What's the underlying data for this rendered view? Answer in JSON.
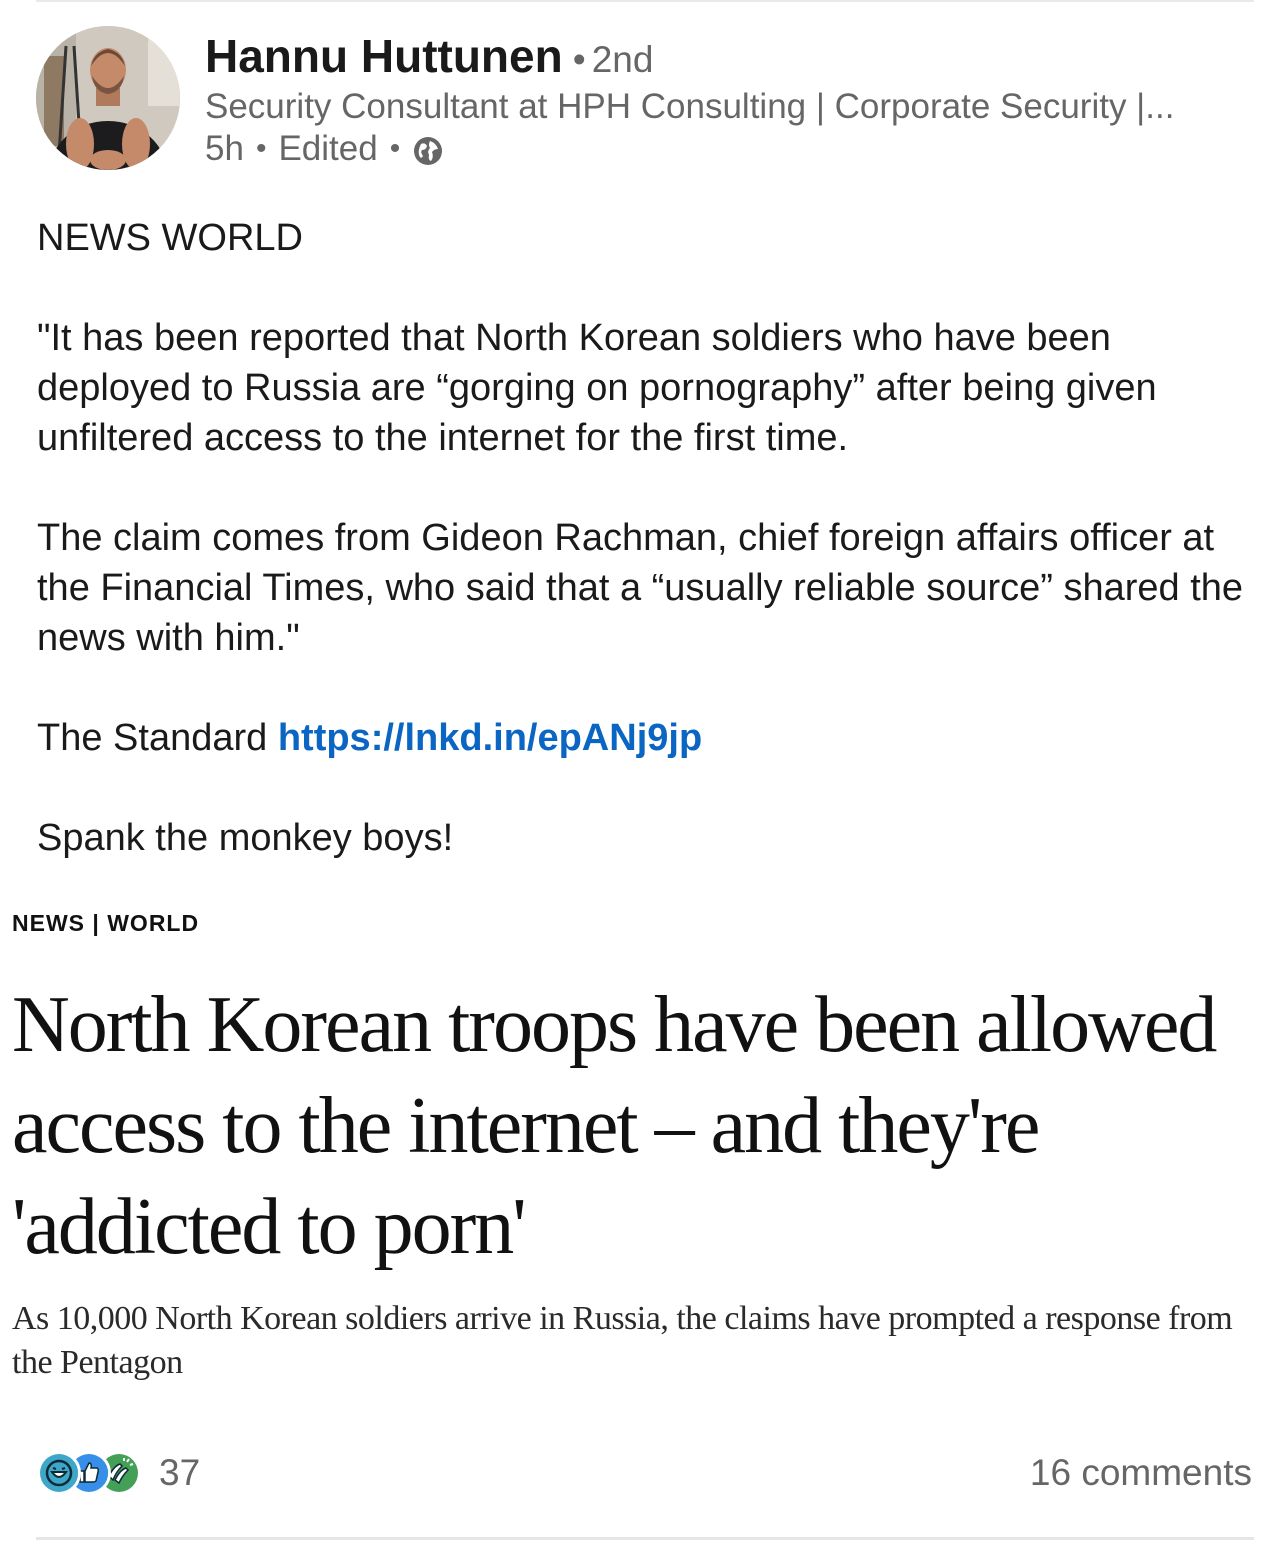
{
  "author": {
    "name": "Hannu Huttunen",
    "degree_separator": "•",
    "degree": "2nd",
    "headline": "Security Consultant at HPH Consulting | Corporate Security |...",
    "time": "5h",
    "meta_separator": "•",
    "edited": "Edited",
    "visibility_icon": "globe-icon"
  },
  "post": {
    "line1": "NEWS WORLD",
    "para1": "\"It has been reported that North Korean soldiers who have been deployed to Russia are “gorging on pornography” after being given unfiltered access to the internet for the first time.",
    "para2": "The claim comes from Gideon Rachman, chief foreign affairs officer at the Financial Times, who said that a “usually reliable source” shared the news with him.\"",
    "source_label": "The Standard",
    "source_link": "https://lnkd.in/epANj9jp",
    "closing": "Spank the monkey boys!"
  },
  "article": {
    "kicker": "NEWS | WORLD",
    "headline": "North Korean troops have been allowed access to the internet – and they're 'addicted to porn'",
    "subheadline": "As 10,000 North Korean soldiers arrive in Russia, the claims have prompted a response from the Pentagon"
  },
  "social": {
    "reaction_icons": [
      "funny-reaction-icon",
      "like-reaction-icon",
      "celebrate-reaction-icon"
    ],
    "reaction_count": "37",
    "comments": "16 comments"
  },
  "colors": {
    "link": "#0a66c2",
    "muted_text": "#666666",
    "funny": "#3ea7c9",
    "like": "#378fe9",
    "celebrate": "#44a056"
  }
}
